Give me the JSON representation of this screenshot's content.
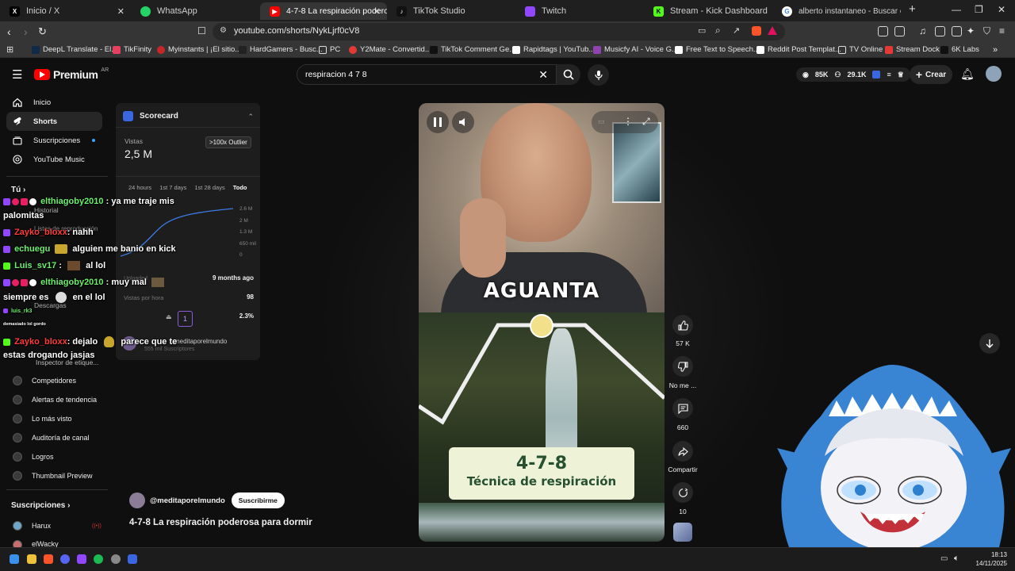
{
  "browser": {
    "tabs": [
      {
        "label": "Inicio / X",
        "icon": "x-logo-icon"
      },
      {
        "label": "WhatsApp",
        "icon": "whatsapp-icon"
      },
      {
        "label": "4-7-8 La respiración poderos",
        "icon": "youtube-icon",
        "active": true
      },
      {
        "label": "TikTok Studio",
        "icon": "tiktok-icon"
      },
      {
        "label": "Twitch",
        "icon": "twitch-icon"
      },
      {
        "label": "Stream - Kick Dashboard",
        "icon": "kick-icon"
      },
      {
        "label": "alberto instantaneo - Buscar con Go",
        "icon": "google-icon"
      }
    ],
    "url": "youtube.com/shorts/NykLjrf0cV8",
    "bookmarks": [
      {
        "label": "DeepL Translate - El...",
        "color": "#0f2b46"
      },
      {
        "label": "TikFinity",
        "color": "#e4405f"
      },
      {
        "label": "Myinstants | ¡El sitio...",
        "color": "#c62828"
      },
      {
        "label": "HardGamers - Busc...",
        "color": "#222222"
      },
      {
        "label": "PC",
        "color": "#f0b429"
      },
      {
        "label": "Y2Mate - Convertid...",
        "color": "#e53935"
      },
      {
        "label": "TikTok Comment Ge...",
        "color": "#111111"
      },
      {
        "label": "Rapidtags | YouTub...",
        "color": "#ffffff"
      },
      {
        "label": "Musicfy AI - Voice G...",
        "color": "#8e44ad"
      },
      {
        "label": "Free Text to Speech...",
        "color": "#ffffff"
      },
      {
        "label": "Reddit Post Templat...",
        "color": "#ffffff"
      },
      {
        "label": "TV Online",
        "color": "#f0b429"
      },
      {
        "label": "Stream Dock",
        "color": "#e53935"
      },
      {
        "label": "6K Labs",
        "color": "#111111"
      }
    ]
  },
  "youtube": {
    "logo_text": "Premium",
    "logo_country": "AR",
    "search_value": "respiracion 4 7 8",
    "stats": {
      "views": "85K",
      "subs": "29.1K"
    },
    "create_label": "Crear"
  },
  "sidebar": {
    "items": [
      {
        "label": "Inicio",
        "icon": "home-icon"
      },
      {
        "label": "Shorts",
        "icon": "shorts-icon",
        "active": true
      },
      {
        "label": "Suscripciones",
        "icon": "subscriptions-icon"
      },
      {
        "label": "YouTube Music",
        "icon": "music-icon"
      }
    ],
    "you_label": "Tú",
    "you_items": [
      "Historial",
      "Listas de reproducción",
      "Tus videos",
      "Descargas",
      "Inspector de etique..."
    ],
    "tools": [
      "Competidores",
      "Alertas de tendencia",
      "Lo más visto",
      "Auditoría de canal",
      "Logros",
      "Thumbnail Preview"
    ],
    "subs_title": "Suscripciones",
    "subs": [
      "Harux",
      "elWacky"
    ]
  },
  "scorecard": {
    "title": "Scorecard",
    "views_label": "Vistas",
    "views_value": "2,5 M",
    "outlier_badge": ">100x Outlier",
    "periods": [
      "24 hours",
      "1st 7 days",
      "1st 28 days",
      "Todo"
    ],
    "y_ticks": [
      "2.6 M",
      "2 M",
      "1.3 M",
      "650 mil",
      "0"
    ],
    "uploaded_label": "Uploaded",
    "uploaded_value": "9 months ago",
    "vph_label": "Vistas por hora",
    "vph_value": "98",
    "engagement_value": "2.3%",
    "page_badge": "1",
    "channel_name": "meditaporelmundo",
    "channel_subs": "555 mil Suscriptores"
  },
  "chat": [
    {
      "user": "elthiagoby2010",
      "user_color": "#6cf06c",
      "msg": ": ya me traje mis"
    },
    {
      "user": "",
      "msg": "palomitas"
    },
    {
      "user": "Zayko_bloxx",
      "user_color": "#ff3b3b",
      "msg": ": nahh"
    },
    {
      "user": "echuegu",
      "user_color": "#6cf06c",
      "msg": "alguien me banio en kick"
    },
    {
      "user": "Luis_sv17",
      "user_color": "#6cf06c",
      "msg": "al lol"
    },
    {
      "user": "elthiagoby2010",
      "user_color": "#6cf06c",
      "msg": ": muy mal"
    },
    {
      "user": "",
      "msg": "siempre es"
    },
    {
      "user": "",
      "msg": "en el lol"
    },
    {
      "user": "luis_rk3",
      "user_color": "#6cf06c",
      "msg": ""
    },
    {
      "user": "",
      "msg": "demasiado lol gordo"
    },
    {
      "user": "Zayko_bloxx",
      "user_color": "#ff3b3b",
      "msg": ": dejalo"
    },
    {
      "user": "",
      "msg": "parece que te"
    },
    {
      "user": "",
      "msg": "estas drogando jasjas"
    }
  ],
  "short": {
    "overlay_word": "AGUANTA",
    "card_title": "4-7-8",
    "card_subtitle": "Técnica de respiración",
    "channel": "@meditaporelmundo",
    "subscribe_label": "Suscribirme",
    "title": "4-7-8 La respiración poderosa para dormir"
  },
  "actions": [
    {
      "label": "57 K",
      "icon": "like-icon"
    },
    {
      "label": "No me ...",
      "icon": "dislike-icon"
    },
    {
      "label": "660",
      "icon": "comment-icon"
    },
    {
      "label": "Compartir",
      "icon": "share-icon"
    },
    {
      "label": "10",
      "icon": "remix-icon"
    }
  ],
  "taskbar": {
    "time": "18:13",
    "date": "14/11/2025"
  }
}
